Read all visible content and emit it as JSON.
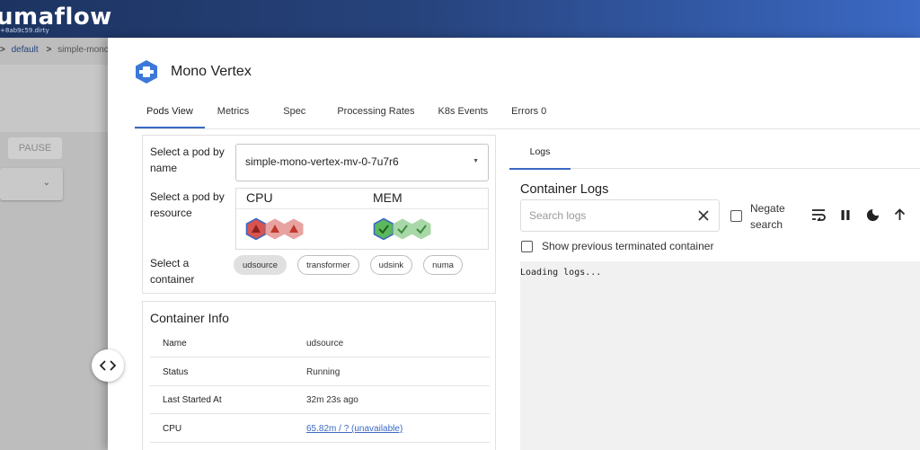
{
  "app": {
    "brand": "umaflow",
    "version": "+8ab9c59.dirty"
  },
  "background": {
    "breadcrumbs": [
      ">",
      "default",
      ">",
      "simple-mono"
    ],
    "pause_label": "PAUSE"
  },
  "drawer": {
    "title": "Mono Vertex",
    "tabs": [
      {
        "label": "Pods View",
        "active": true
      },
      {
        "label": "Metrics"
      },
      {
        "label": "Spec"
      },
      {
        "label": "Processing Rates"
      },
      {
        "label": "K8s Events"
      },
      {
        "label": "Errors 0"
      }
    ]
  },
  "pods": {
    "select_by_name_label": "Select a pod by name",
    "selected_pod": "simple-mono-vertex-mv-0-7u7r6",
    "select_by_resource_label": "Select a pod by resource",
    "cpu_label": "CPU",
    "mem_label": "MEM",
    "cpu_status": [
      "error",
      "error",
      "error"
    ],
    "mem_status": [
      "ok",
      "ok",
      "ok"
    ],
    "select_container_label": "Select a container",
    "containers": [
      "udsource",
      "transformer",
      "udsink",
      "numa"
    ],
    "selected_container": "udsource"
  },
  "container_info": {
    "title": "Container Info",
    "rows": [
      {
        "key": "Name",
        "value": "udsource"
      },
      {
        "key": "Status",
        "value": "Running"
      },
      {
        "key": "Last Started At",
        "value": "32m 23s ago"
      },
      {
        "key": "CPU",
        "value": "65.82m / ? (unavailable)"
      }
    ]
  },
  "logs": {
    "tab_label": "Logs",
    "heading": "Container Logs",
    "search_placeholder": "Search logs",
    "negate_label": "Negate search",
    "prev_terminated_label": "Show previous terminated container",
    "content": "Loading logs...",
    "toolbar_icons": [
      "wrap-icon",
      "pause-icon",
      "dark-mode-icon",
      "scroll-top-icon"
    ]
  },
  "colors": {
    "accent": "#3b69c4",
    "error_hex": "#d9534f",
    "ok_hex": "#5cb85c"
  }
}
